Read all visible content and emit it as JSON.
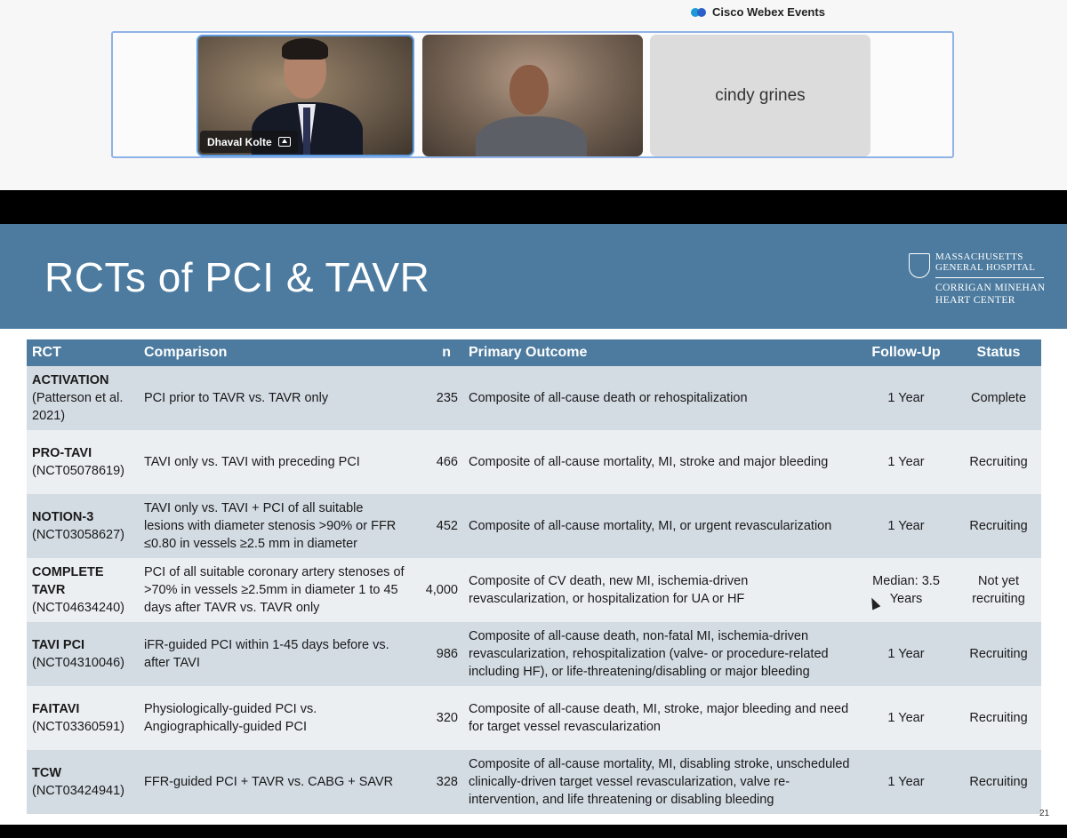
{
  "app": {
    "brand": "Cisco Webex Events",
    "icon": "webex-logo-icon"
  },
  "participants": [
    {
      "name": "Dhaval Kolte",
      "sharing": true
    },
    {
      "name": ""
    },
    {
      "name": "cindy grines"
    }
  ],
  "slide": {
    "title": "RCTs of PCI & TAVR",
    "logo": {
      "line1": "MASSACHUSETTS GENERAL HOSPITAL",
      "line2": "CORRIGAN MINEHAN HEART CENTER"
    },
    "page_number": "21",
    "table": {
      "headers": [
        "RCT",
        "Comparison",
        "n",
        "Primary Outcome",
        "Follow-Up",
        "Status"
      ],
      "rows": [
        {
          "name": "ACTIVATION",
          "ref": "(Patterson et al. 2021)",
          "comparison": "PCI prior to TAVR vs. TAVR only",
          "n": "235",
          "outcome": "Composite of all-cause death or rehospitalization",
          "followup": "1 Year",
          "status": "Complete"
        },
        {
          "name": "PRO-TAVI",
          "ref": "(NCT05078619)",
          "comparison": "TAVI only vs. TAVI with preceding PCI",
          "n": "466",
          "outcome": "Composite of all-cause mortality, MI, stroke and major bleeding",
          "followup": "1 Year",
          "status": "Recruiting"
        },
        {
          "name": "NOTION-3",
          "ref": "(NCT03058627)",
          "comparison": "TAVI only vs. TAVI + PCI of all suitable lesions with diameter stenosis >90% or FFR ≤0.80 in vessels ≥2.5 mm in diameter",
          "n": "452",
          "outcome": "Composite of all-cause mortality, MI, or urgent revascularization",
          "followup": "1 Year",
          "status": "Recruiting"
        },
        {
          "name": "COMPLETE TAVR",
          "ref": "(NCT04634240)",
          "comparison": "PCI of all suitable coronary artery stenoses of >70% in vessels ≥2.5mm in diameter 1 to 45 days after TAVR vs. TAVR only",
          "n": "4,000",
          "outcome": "Composite of CV death, new MI, ischemia-driven revascularization, or hospitalization for UA or HF",
          "followup": "Median: 3.5 Years",
          "status": "Not yet recruiting"
        },
        {
          "name": "TAVI PCI",
          "ref": "(NCT04310046)",
          "comparison": "iFR-guided PCI within 1-45 days before vs. after TAVI",
          "n": "986",
          "outcome": "Composite of all-cause death, non-fatal MI, ischemia-driven revascularization, rehospitalization (valve- or procedure-related including HF), or life-threatening/disabling or major bleeding",
          "followup": "1 Year",
          "status": "Recruiting"
        },
        {
          "name": "FAITAVI",
          "ref": "(NCT03360591)",
          "comparison": "Physiologically-guided PCI vs. Angiographically-guided PCI",
          "n": "320",
          "outcome": "Composite of all-cause death, MI, stroke, major bleeding and need for target vessel revascularization",
          "followup": "1 Year",
          "status": "Recruiting"
        },
        {
          "name": "TCW",
          "ref": "(NCT03424941)",
          "comparison": "FFR-guided PCI + TAVR vs. CABG + SAVR",
          "n": "328",
          "outcome": "Composite of all-cause mortality, MI, disabling stroke, unscheduled clinically-driven target vessel revascularization, valve re-intervention, and life threatening or disabling bleeding",
          "followup": "1 Year",
          "status": "Recruiting"
        }
      ]
    }
  },
  "colors": {
    "slide_blue": "#4c7b9f",
    "row_dark": "#d3dbe3",
    "row_light": "#eceff2",
    "active_tile": "#5b9be0"
  }
}
